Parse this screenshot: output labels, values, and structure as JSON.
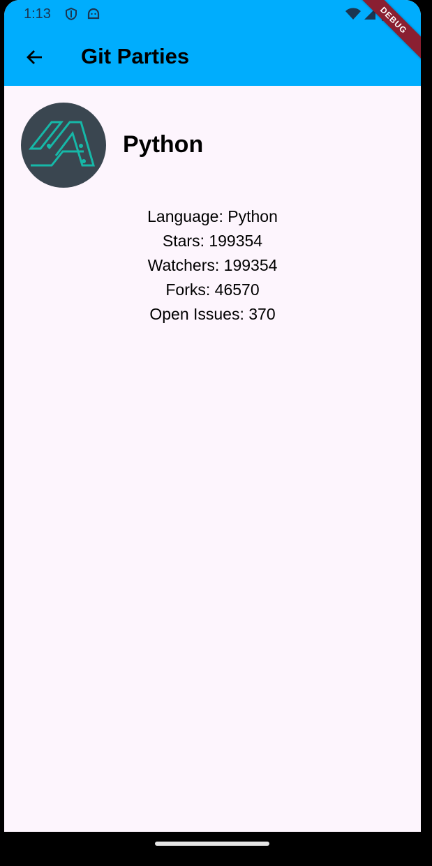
{
  "status_bar": {
    "time": "1:13",
    "left_icons": [
      "shield-icon",
      "android-robot-icon"
    ],
    "right_icons": [
      "wifi-icon",
      "cellular-signal-icon",
      "battery-icon"
    ],
    "background": "#00adfd"
  },
  "app_bar": {
    "title": "Git Parties",
    "back_icon": "arrow-back-icon",
    "background": "#00adfd"
  },
  "debug_banner": {
    "label": "DEBUG",
    "color": "#8a1f31"
  },
  "repo": {
    "name": "Python",
    "avatar_icon": "repo-logo-icon",
    "details": [
      "Language: Python",
      "Stars: 199354",
      "Watchers: 199354",
      "Forks: 46570",
      "Open Issues: 370"
    ]
  },
  "colors": {
    "page_background": "#fdf5fd",
    "avatar_background": "#3a4650",
    "logo_accent": "#16b8a8"
  }
}
